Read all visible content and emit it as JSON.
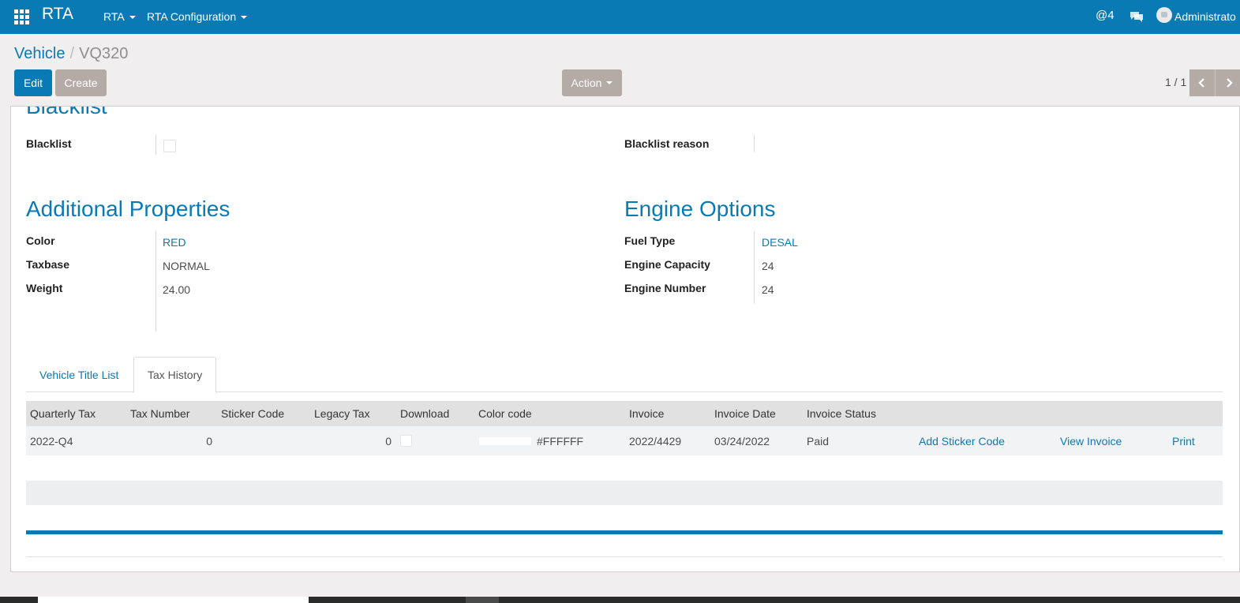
{
  "navbar": {
    "brand": "RTA",
    "menus": [
      "RTA",
      "RTA Configuration"
    ],
    "mentions_count": "@4",
    "user": "Administrato"
  },
  "breadcrumb": {
    "parent": "Vehicle",
    "separator": "/",
    "current": "VQ320"
  },
  "buttons": {
    "edit": "Edit",
    "create": "Create",
    "action": "Action"
  },
  "pager": {
    "value": "1 / 1"
  },
  "blacklist": {
    "title": "Blacklist",
    "blacklist_label": "Blacklist",
    "blacklist_checked": false,
    "reason_label": "Blacklist reason",
    "reason_value": ""
  },
  "additional": {
    "title": "Additional Properties",
    "fields": [
      {
        "label": "Color",
        "value": "RED"
      },
      {
        "label": "Taxbase",
        "value": "NORMAL"
      },
      {
        "label": "Weight",
        "value": "24.00"
      }
    ]
  },
  "engine": {
    "title": "Engine Options",
    "fields": [
      {
        "label": "Fuel Type",
        "value": "DESAL"
      },
      {
        "label": "Engine Capacity",
        "value": "24"
      },
      {
        "label": "Engine Number",
        "value": "24"
      }
    ]
  },
  "tabs": [
    "Vehicle Title List",
    "Tax History"
  ],
  "active_tab": "Tax History",
  "table": {
    "columns": [
      "Quarterly Tax",
      "Tax Number",
      "Sticker Code",
      "Legacy Tax",
      "Download",
      "Color code",
      "Invoice",
      "Invoice Date",
      "Invoice Status"
    ],
    "rows": [
      {
        "quarterly_tax": "2022-Q4",
        "tax_number": "0",
        "sticker_code": "",
        "legacy_tax": "0",
        "download_checked": false,
        "color_code": "#FFFFFF",
        "invoice": "2022/4429",
        "invoice_date": "03/24/2022",
        "invoice_status": "Paid",
        "actions": [
          "Add Sticker Code",
          "View Invoice",
          "Print"
        ]
      }
    ]
  },
  "colors": {
    "primary": "#0a7ab5",
    "secondary_button": "#b4aba6",
    "background": "#f0eeee"
  }
}
